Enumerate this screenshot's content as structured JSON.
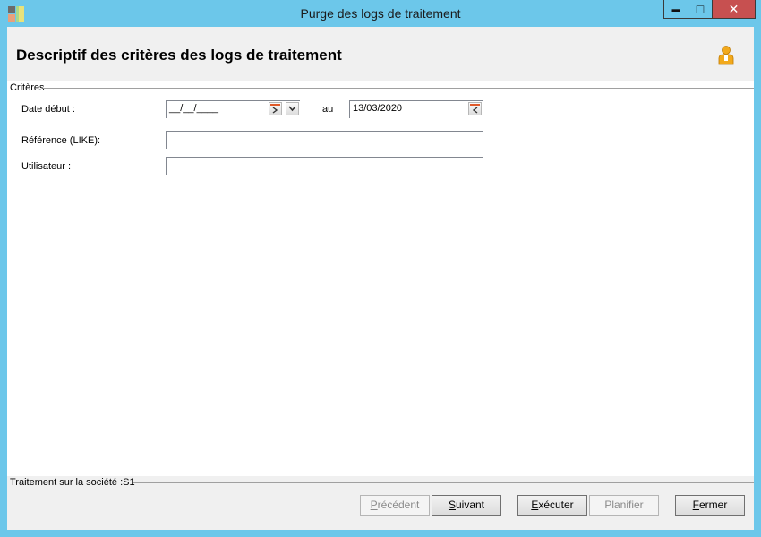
{
  "window": {
    "title": "Purge des logs de traitement",
    "controls": {
      "minimize": "▬",
      "maximize": "□",
      "close": "✕"
    }
  },
  "header": {
    "title": "Descriptif des critères des logs de traitement",
    "icon": "user-icon"
  },
  "criteria": {
    "group_label": "Critères",
    "date_debut": {
      "label": "Date début :",
      "value": "__/__/____"
    },
    "au_label": "au",
    "date_fin": {
      "value": "13/03/2020"
    },
    "reference": {
      "label": "Référence (LIKE):",
      "value": ""
    },
    "utilisateur": {
      "label": "Utilisateur :",
      "value": ""
    }
  },
  "footer": {
    "label": "Traitement sur la société :S1",
    "buttons": {
      "precedent": {
        "first": "P",
        "rest": "récédent"
      },
      "suivant": {
        "first": "S",
        "rest": "uivant"
      },
      "executer": {
        "first": "E",
        "rest": "xécuter"
      },
      "planifier": {
        "label": "Planifier"
      },
      "fermer": {
        "first": "F",
        "rest": "ermer"
      }
    }
  },
  "colors": {
    "titlebar": "#6cc7ea",
    "close_button": "#c75050",
    "band": "#f0f0f0"
  }
}
